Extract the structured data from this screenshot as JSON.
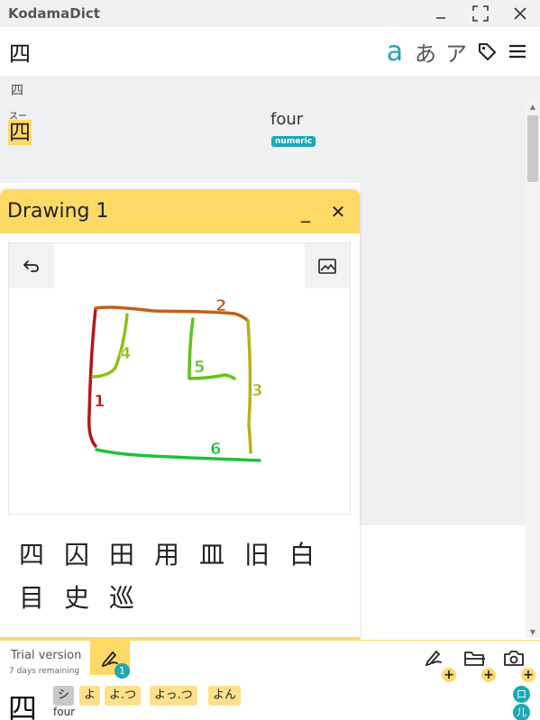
{
  "window": {
    "title": "KodamaDict"
  },
  "search": {
    "value": "四"
  },
  "modes": {
    "romaji": "a",
    "hiragana": "あ",
    "katakana": "ア"
  },
  "query_header": "四",
  "result": {
    "furigana": "スー",
    "kanji": "四",
    "gloss": "four",
    "tag": "numeric"
  },
  "drawing": {
    "title": "Drawing 1",
    "minimize": "_",
    "close": "✕",
    "stroke_numbers": [
      "1",
      "2",
      "3",
      "4",
      "5",
      "6"
    ],
    "stroke_colors": [
      "#b11818",
      "#c0601a",
      "#b5b01a",
      "#8fbf1a",
      "#5ec41a",
      "#1fc23a"
    ],
    "candidates": [
      "四",
      "囚",
      "田",
      "用",
      "皿",
      "旧",
      "白",
      "目",
      "史",
      "巡"
    ]
  },
  "footer": {
    "trial": "Trial version",
    "trial_sub": "7 days remaining",
    "drawing_count": "1",
    "plus": "+",
    "kanji": "四",
    "readings": [
      "シ",
      "よ",
      "よ.つ",
      "よっ.つ",
      "よん"
    ],
    "meaning": "four",
    "radicals": [
      "口",
      "儿"
    ]
  },
  "colors": {
    "accent": "#1ea7b5",
    "highlight": "#ffd966"
  }
}
